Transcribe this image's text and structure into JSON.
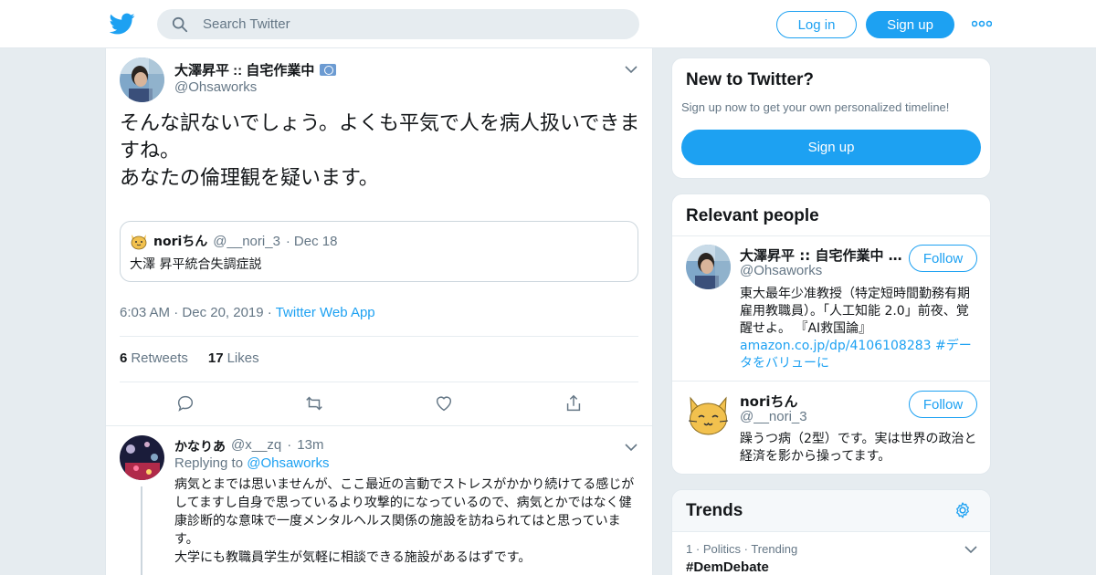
{
  "header": {
    "search_placeholder": "Search Twitter",
    "login_label": "Log in",
    "signup_label": "Sign up"
  },
  "tweet": {
    "author_name": "大澤昇平 :: 自宅作業中",
    "author_handle": "@Ohsaworks",
    "text": "そんな訳ないでしょう。よくも平気で人を病人扱いできますね。\nあなたの倫理観を疑います。",
    "quote": {
      "author_name": "noriちん",
      "author_handle": "@__nori_3",
      "date": "Dec 18",
      "text": "大澤 昇平統合失調症説"
    },
    "time": "6:03 AM",
    "date": "Dec 20, 2019",
    "source": "Twitter Web App",
    "retweets_count": "6",
    "retweets_label": "Retweets",
    "likes_count": "17",
    "likes_label": "Likes"
  },
  "reply": {
    "author_name": "かなりあ",
    "author_handle": "@x__zq",
    "time": "13m",
    "replying_label": "Replying to",
    "replying_to": "@Ohsaworks",
    "text": "病気とまでは思いませんが、ここ最近の言動でストレスがかかり続けてる感じがしてますし自身で思っているより攻撃的になっているので、病気とかではなく健康診断的な意味で一度メンタルヘルス関係の施設を訪ねられてはと思っています。\n大学にも教職員学生が気軽に相談できる施設があるはずです。"
  },
  "new_to_twitter": {
    "title": "New to Twitter?",
    "subtitle": "Sign up now to get your own personalized timeline!",
    "button": "Sign up"
  },
  "relevant_people": {
    "title": "Relevant people",
    "follow_label": "Follow",
    "people": [
      {
        "name": "大澤昇平 :: 自宅作業中 …",
        "handle": "@Ohsaworks",
        "bio": "東大最年少准教授（特定短時間勤務有期雇用教職員）。「人工知能 2.0」前夜、覚醒せよ。 『AI救国論』",
        "bio_link": "amazon.co.jp/dp/4106108283 #データをバリューに"
      },
      {
        "name": "noriちん",
        "handle": "@__nori_3",
        "bio": "躁うつ病（2型）です。実は世界の政治と経済を影から操ってます。"
      }
    ]
  },
  "trends": {
    "title": "Trends",
    "items": [
      {
        "rank": "1",
        "category": "Politics",
        "status": "Trending",
        "name": "#DemDebate"
      }
    ]
  },
  "colors": {
    "brand": "#1da1f2",
    "text": "#14171a",
    "muted": "#657786",
    "background": "#e6ecf0"
  }
}
